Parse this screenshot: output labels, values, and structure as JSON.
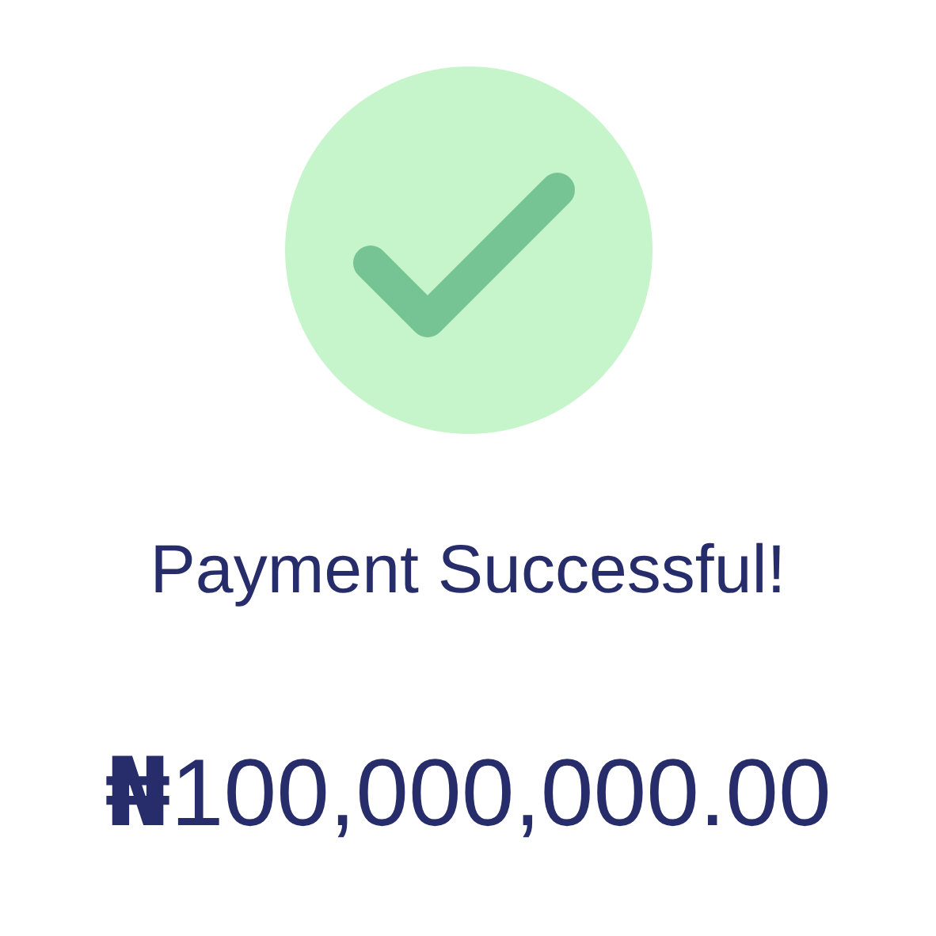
{
  "title": "Payment Successful!",
  "amount": "**₦**100,000,000.00"
}
